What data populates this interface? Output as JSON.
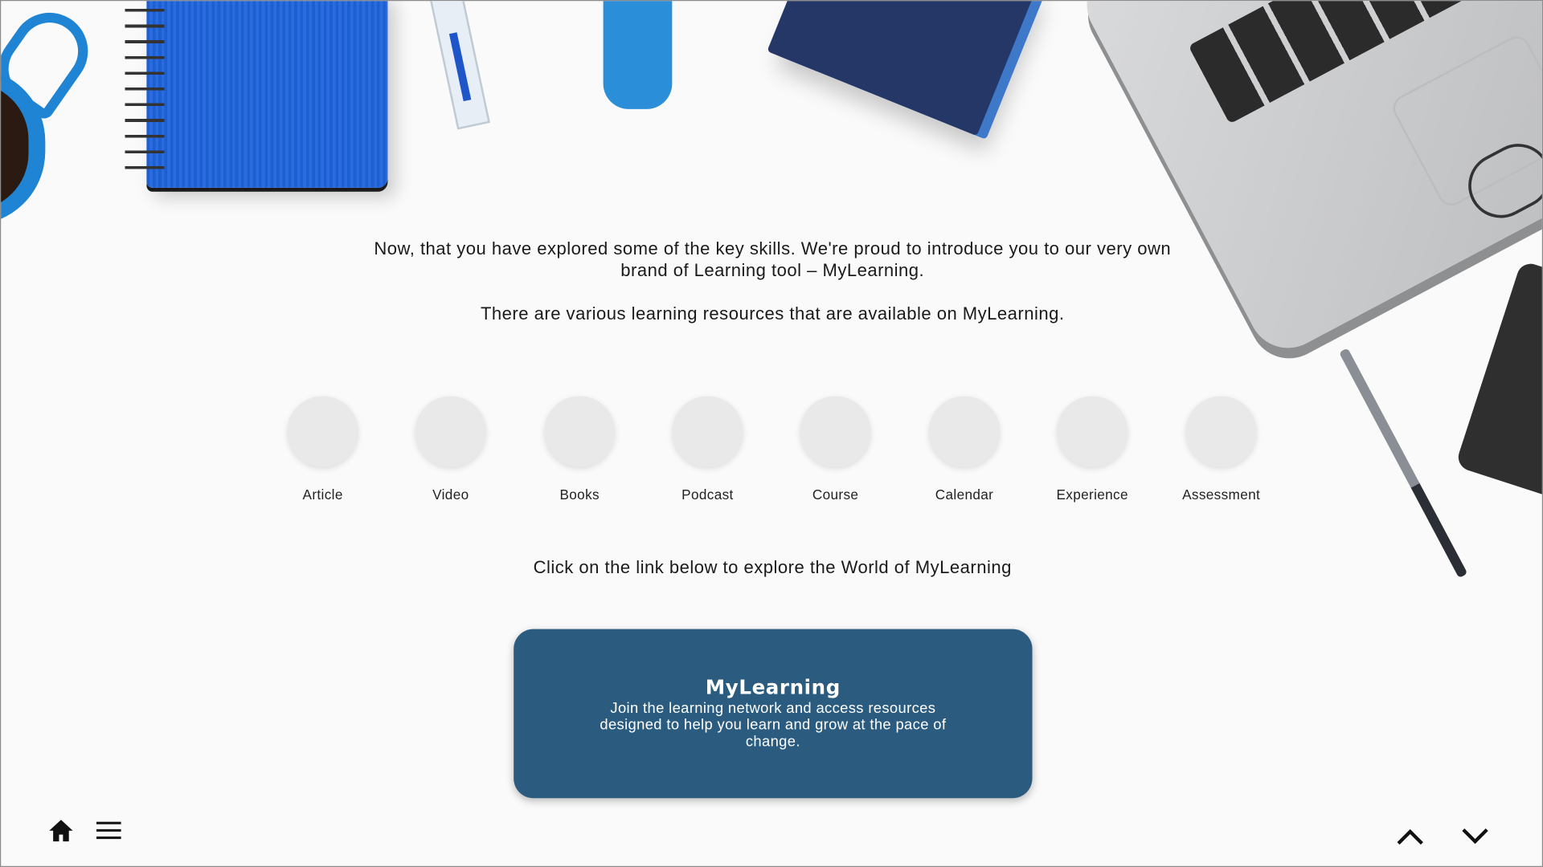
{
  "intro": {
    "line1": "Now, that you have explored some of the key skills. We're proud to introduce you to our very own brand of Learning tool – MyLearning.",
    "line2": "There are various learning resources that are available on MyLearning."
  },
  "resources": [
    {
      "label": "Article"
    },
    {
      "label": "Video"
    },
    {
      "label": "Books"
    },
    {
      "label": "Podcast"
    },
    {
      "label": "Course"
    },
    {
      "label": "Calendar"
    },
    {
      "label": "Experience"
    },
    {
      "label": "Assessment"
    }
  ],
  "cta": {
    "text": "Click on the link below to explore the World of MyLearning"
  },
  "card": {
    "title": "MyLearning",
    "description": "Join the learning network and access resources designed to help you learn and grow at the pace of change."
  },
  "nav": {
    "home_icon": "home-icon",
    "menu_icon": "hamburger-menu-icon",
    "prev_icon": "chevron-up-icon",
    "next_icon": "chevron-down-icon"
  },
  "colors": {
    "card_background": "#2b5c80",
    "page_background": "#fafafa"
  }
}
